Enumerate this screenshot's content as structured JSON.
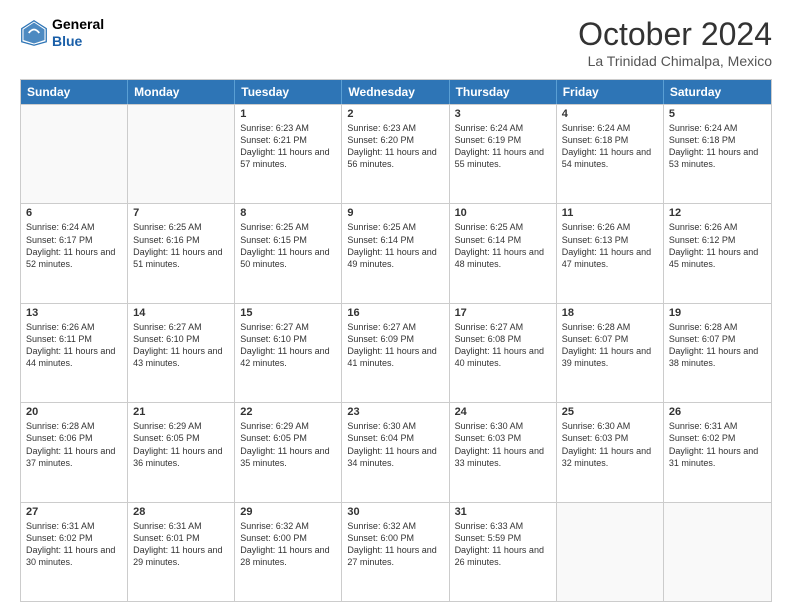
{
  "header": {
    "logo": {
      "line1": "General",
      "line2": "Blue"
    },
    "title": "October 2024",
    "subtitle": "La Trinidad Chimalpa, Mexico"
  },
  "days_of_week": [
    "Sunday",
    "Monday",
    "Tuesday",
    "Wednesday",
    "Thursday",
    "Friday",
    "Saturday"
  ],
  "weeks": [
    [
      {
        "day": "",
        "empty": true
      },
      {
        "day": "",
        "empty": true
      },
      {
        "day": "1",
        "sunrise": "Sunrise: 6:23 AM",
        "sunset": "Sunset: 6:21 PM",
        "daylight": "Daylight: 11 hours and 57 minutes."
      },
      {
        "day": "2",
        "sunrise": "Sunrise: 6:23 AM",
        "sunset": "Sunset: 6:20 PM",
        "daylight": "Daylight: 11 hours and 56 minutes."
      },
      {
        "day": "3",
        "sunrise": "Sunrise: 6:24 AM",
        "sunset": "Sunset: 6:19 PM",
        "daylight": "Daylight: 11 hours and 55 minutes."
      },
      {
        "day": "4",
        "sunrise": "Sunrise: 6:24 AM",
        "sunset": "Sunset: 6:18 PM",
        "daylight": "Daylight: 11 hours and 54 minutes."
      },
      {
        "day": "5",
        "sunrise": "Sunrise: 6:24 AM",
        "sunset": "Sunset: 6:18 PM",
        "daylight": "Daylight: 11 hours and 53 minutes."
      }
    ],
    [
      {
        "day": "6",
        "sunrise": "Sunrise: 6:24 AM",
        "sunset": "Sunset: 6:17 PM",
        "daylight": "Daylight: 11 hours and 52 minutes."
      },
      {
        "day": "7",
        "sunrise": "Sunrise: 6:25 AM",
        "sunset": "Sunset: 6:16 PM",
        "daylight": "Daylight: 11 hours and 51 minutes."
      },
      {
        "day": "8",
        "sunrise": "Sunrise: 6:25 AM",
        "sunset": "Sunset: 6:15 PM",
        "daylight": "Daylight: 11 hours and 50 minutes."
      },
      {
        "day": "9",
        "sunrise": "Sunrise: 6:25 AM",
        "sunset": "Sunset: 6:14 PM",
        "daylight": "Daylight: 11 hours and 49 minutes."
      },
      {
        "day": "10",
        "sunrise": "Sunrise: 6:25 AM",
        "sunset": "Sunset: 6:14 PM",
        "daylight": "Daylight: 11 hours and 48 minutes."
      },
      {
        "day": "11",
        "sunrise": "Sunrise: 6:26 AM",
        "sunset": "Sunset: 6:13 PM",
        "daylight": "Daylight: 11 hours and 47 minutes."
      },
      {
        "day": "12",
        "sunrise": "Sunrise: 6:26 AM",
        "sunset": "Sunset: 6:12 PM",
        "daylight": "Daylight: 11 hours and 45 minutes."
      }
    ],
    [
      {
        "day": "13",
        "sunrise": "Sunrise: 6:26 AM",
        "sunset": "Sunset: 6:11 PM",
        "daylight": "Daylight: 11 hours and 44 minutes."
      },
      {
        "day": "14",
        "sunrise": "Sunrise: 6:27 AM",
        "sunset": "Sunset: 6:10 PM",
        "daylight": "Daylight: 11 hours and 43 minutes."
      },
      {
        "day": "15",
        "sunrise": "Sunrise: 6:27 AM",
        "sunset": "Sunset: 6:10 PM",
        "daylight": "Daylight: 11 hours and 42 minutes."
      },
      {
        "day": "16",
        "sunrise": "Sunrise: 6:27 AM",
        "sunset": "Sunset: 6:09 PM",
        "daylight": "Daylight: 11 hours and 41 minutes."
      },
      {
        "day": "17",
        "sunrise": "Sunrise: 6:27 AM",
        "sunset": "Sunset: 6:08 PM",
        "daylight": "Daylight: 11 hours and 40 minutes."
      },
      {
        "day": "18",
        "sunrise": "Sunrise: 6:28 AM",
        "sunset": "Sunset: 6:07 PM",
        "daylight": "Daylight: 11 hours and 39 minutes."
      },
      {
        "day": "19",
        "sunrise": "Sunrise: 6:28 AM",
        "sunset": "Sunset: 6:07 PM",
        "daylight": "Daylight: 11 hours and 38 minutes."
      }
    ],
    [
      {
        "day": "20",
        "sunrise": "Sunrise: 6:28 AM",
        "sunset": "Sunset: 6:06 PM",
        "daylight": "Daylight: 11 hours and 37 minutes."
      },
      {
        "day": "21",
        "sunrise": "Sunrise: 6:29 AM",
        "sunset": "Sunset: 6:05 PM",
        "daylight": "Daylight: 11 hours and 36 minutes."
      },
      {
        "day": "22",
        "sunrise": "Sunrise: 6:29 AM",
        "sunset": "Sunset: 6:05 PM",
        "daylight": "Daylight: 11 hours and 35 minutes."
      },
      {
        "day": "23",
        "sunrise": "Sunrise: 6:30 AM",
        "sunset": "Sunset: 6:04 PM",
        "daylight": "Daylight: 11 hours and 34 minutes."
      },
      {
        "day": "24",
        "sunrise": "Sunrise: 6:30 AM",
        "sunset": "Sunset: 6:03 PM",
        "daylight": "Daylight: 11 hours and 33 minutes."
      },
      {
        "day": "25",
        "sunrise": "Sunrise: 6:30 AM",
        "sunset": "Sunset: 6:03 PM",
        "daylight": "Daylight: 11 hours and 32 minutes."
      },
      {
        "day": "26",
        "sunrise": "Sunrise: 6:31 AM",
        "sunset": "Sunset: 6:02 PM",
        "daylight": "Daylight: 11 hours and 31 minutes."
      }
    ],
    [
      {
        "day": "27",
        "sunrise": "Sunrise: 6:31 AM",
        "sunset": "Sunset: 6:02 PM",
        "daylight": "Daylight: 11 hours and 30 minutes."
      },
      {
        "day": "28",
        "sunrise": "Sunrise: 6:31 AM",
        "sunset": "Sunset: 6:01 PM",
        "daylight": "Daylight: 11 hours and 29 minutes."
      },
      {
        "day": "29",
        "sunrise": "Sunrise: 6:32 AM",
        "sunset": "Sunset: 6:00 PM",
        "daylight": "Daylight: 11 hours and 28 minutes."
      },
      {
        "day": "30",
        "sunrise": "Sunrise: 6:32 AM",
        "sunset": "Sunset: 6:00 PM",
        "daylight": "Daylight: 11 hours and 27 minutes."
      },
      {
        "day": "31",
        "sunrise": "Sunrise: 6:33 AM",
        "sunset": "Sunset: 5:59 PM",
        "daylight": "Daylight: 11 hours and 26 minutes."
      },
      {
        "day": "",
        "empty": true
      },
      {
        "day": "",
        "empty": true
      }
    ]
  ]
}
